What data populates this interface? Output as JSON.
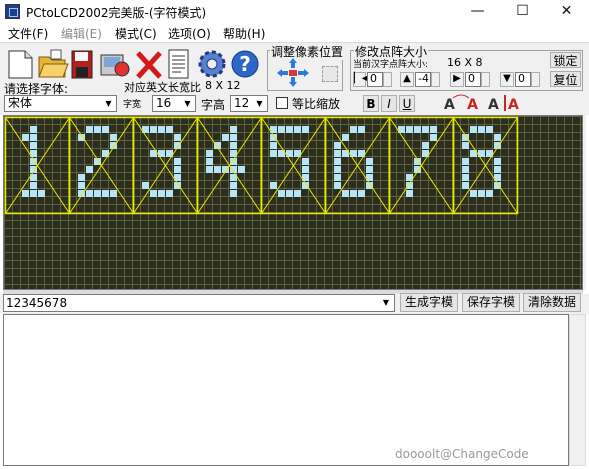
{
  "window": {
    "title": "PCtoLCD2002完美版-(字符模式)",
    "minimize": "—",
    "maximize": "☐",
    "close": "✕"
  },
  "menu": {
    "items": [
      "文件(F)",
      "编辑(E)",
      "模式(C)",
      "选项(O)",
      "帮助(H)"
    ]
  },
  "toolbar": {
    "icons": [
      "new-file-icon",
      "open-folder-icon",
      "save-disk-icon",
      "export-icon",
      "delete-x-icon",
      "notes-icon",
      "settings-gear-icon",
      "help-icon"
    ]
  },
  "adjust_group": {
    "label": "调整像素位置"
  },
  "dotmatrix_group": {
    "label": "修改点阵大小",
    "current_label": "当前汉字点阵大小:",
    "current_size": "16 X 8",
    "spin_values": [
      "0",
      "-4",
      "0",
      "0"
    ],
    "lock_label": "锁定",
    "reset_label": "复位"
  },
  "font": {
    "select_label": "请选择字体:",
    "font_value": "宋体",
    "ascii_size_label": "对应英文长宽比",
    "ascii_size": "8 X 12",
    "width_label": "字宽",
    "width_value": "16",
    "height_label": "字高",
    "height_value": "12",
    "proportional_label": "等比缩放",
    "bold": "B",
    "italic": "I",
    "underline": "U"
  },
  "matrix": {
    "text": "12345678",
    "background": "#2b2d1d",
    "grid_color": "#5f6140",
    "lit_color": "#b7e4f6",
    "cell_border_color": "#e8e800",
    "glyph_cols": 8,
    "glyph_rows": 12
  },
  "input": {
    "value": "12345678"
  },
  "buttons": {
    "generate": "生成字模",
    "save": "保存字模",
    "clear": "清除数据"
  },
  "watermark": "doooolt@ChangeCode"
}
